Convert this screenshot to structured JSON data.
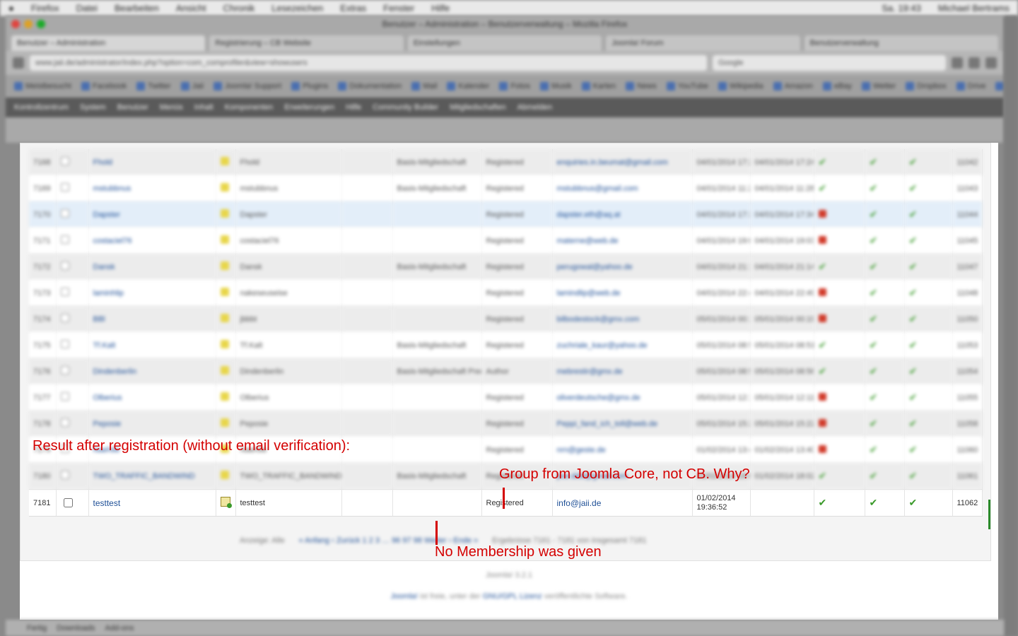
{
  "menubar": {
    "items": [
      "Firefox",
      "Datei",
      "Bearbeiten",
      "Ansicht",
      "Chronik",
      "Lesezeichen",
      "Extras",
      "Fenster",
      "Hilfe"
    ],
    "clock": "Sa. 19:43",
    "user": "Michael Bertrams"
  },
  "window": {
    "title": "Benutzer – Administration – Benutzerverwaltung – Mozilla Firefox",
    "tabs": [
      "Benutzer – Administration",
      "Registrierung – CB Website",
      "Einstellungen",
      "Joomla! Forum",
      "Benutzerverwaltung"
    ],
    "url": "www.jaii.de/administrator/index.php?option=com_comprofiler&view=showusers",
    "search": "Google"
  },
  "bookmarks": [
    "Meistbesucht",
    "Facebook",
    "Twitter",
    "Jaii",
    "Joomla! Support",
    "Plugins",
    "Dokumentation",
    "Mail",
    "Kalender",
    "Fotos",
    "Musik",
    "Karten",
    "News",
    "YouTube",
    "Wikipedia",
    "Amazon",
    "eBay",
    "Wetter",
    "Dropbox",
    "Drive",
    "Notizen",
    "Kontakte",
    "Einstellungen"
  ],
  "adminbar": [
    "Kontrollzentrum",
    "System",
    "Benutzer",
    "Menüs",
    "Inhalt",
    "Komponenten",
    "Erweiterungen",
    "Hilfe",
    "Community Builder",
    "Mitgliedschaften",
    "Abmelden"
  ],
  "table": {
    "blurred_rows": [
      {
        "id": "7168",
        "username": "Fhold",
        "name": "Fhold",
        "membership": "Basis-Mitgliedschaft",
        "group": "Registered",
        "email": "enquiries.in.beumat@gmail.com",
        "date1": "04/01/2014 17:24:22",
        "date2": "04/01/2014 17:24:22",
        "status": [
          "ok",
          "ok",
          "ok"
        ],
        "uid": "11042"
      },
      {
        "id": "7169",
        "username": "mstubbnus",
        "name": "mstubbnus",
        "membership": "Basis-Mitgliedschaft",
        "group": "Registered",
        "email": "mstubbnus@gmail.com",
        "date1": "04/01/2014 11:28:00",
        "date2": "04/01/2014 11:28:00",
        "status": [
          "ok",
          "ok",
          "ok"
        ],
        "uid": "11043"
      },
      {
        "id": "7170",
        "username": "Dapster",
        "name": "Dapster",
        "membership": "",
        "group": "Registered",
        "email": "dapster.eth@aq.at",
        "date1": "04/01/2014 17:34:02",
        "date2": "04/01/2014 17:34:02",
        "status": [
          "bad",
          "ok",
          "ok"
        ],
        "uid": "11044"
      },
      {
        "id": "7171",
        "username": "costaciel76",
        "name": "costaciel76",
        "membership": "",
        "group": "Registered",
        "email": "materne@web.de",
        "date1": "04/01/2014 19:03:11",
        "date2": "04/01/2014 19:03:11",
        "status": [
          "bad",
          "ok",
          "ok"
        ],
        "uid": "11045"
      },
      {
        "id": "7172",
        "username": "Dansk",
        "name": "Dansk",
        "membership": "Basis-Mitgliedschaft",
        "group": "Registered",
        "email": "perugowal@yahoo.de",
        "date1": "04/01/2014 21:14:06",
        "date2": "04/01/2014 21:14:06",
        "status": [
          "ok",
          "ok",
          "ok"
        ],
        "uid": "11047"
      },
      {
        "id": "7173",
        "username": "laminhlip",
        "name": "nakeseuseise",
        "membership": "",
        "group": "Registered",
        "email": "lamindlip@web.de",
        "date1": "04/01/2014 22:49:51",
        "date2": "04/01/2014 22:49:51",
        "status": [
          "bad",
          "ok",
          "ok"
        ],
        "uid": "11048"
      },
      {
        "id": "7174",
        "username": "BBl",
        "name": "jbbbt",
        "membership": "",
        "group": "Registered",
        "email": "bilbodestock@gmx.com",
        "date1": "05/01/2014 00:19:12",
        "date2": "05/01/2014 00:19:12",
        "status": [
          "bad",
          "ok",
          "ok"
        ],
        "uid": "11050"
      },
      {
        "id": "7175",
        "username": "Tf.Kalt",
        "name": "Tf.Kalt",
        "membership": "Basis-Mitgliedschaft",
        "group": "Registered",
        "email": "zuchriale_kaur@yahoo.de",
        "date1": "05/01/2014 08:51:37",
        "date2": "05/01/2014 08:51:37",
        "status": [
          "ok",
          "ok",
          "ok"
        ],
        "uid": "11053"
      },
      {
        "id": "7176",
        "username": "Dindenberlin",
        "name": "Dindenberlin",
        "membership": "Basis-Mitgliedschaft Premium",
        "group": "Author",
        "email": "mebrestir@gmx.de",
        "date1": "05/01/2014 08:56:12",
        "date2": "05/01/2014 08:56:12",
        "status": [
          "ok",
          "ok",
          "ok"
        ],
        "uid": "11054"
      },
      {
        "id": "7177",
        "username": "Olberius",
        "name": "Olberius",
        "membership": "",
        "group": "Registered",
        "email": "oliverdeutsche@gmx.de",
        "date1": "05/01/2014 12:11:23",
        "date2": "05/01/2014 12:11:23",
        "status": [
          "bad",
          "ok",
          "ok"
        ],
        "uid": "11055"
      },
      {
        "id": "7178",
        "username": "Peposie",
        "name": "Peposie",
        "membership": "",
        "group": "Registered",
        "email": "Peppi_fand_ich_toll@web.de",
        "date1": "05/01/2014 15:22:31",
        "date2": "05/01/2014 15:22:31",
        "status": [
          "bad",
          "ok",
          "ok"
        ],
        "uid": "11058"
      },
      {
        "id": "7179",
        "username": "Naehtle",
        "name": "Naehtle",
        "membership": "",
        "group": "Registered",
        "email": "nrn@geste.de",
        "date1": "01/02/2014 13:40:02",
        "date2": "01/02/2014 13:40:02",
        "status": [
          "bad",
          "ok",
          "ok"
        ],
        "uid": "11060"
      },
      {
        "id": "7180",
        "username": "TWO_TRAFFIC_BANDWIND",
        "name": "TWO_TRAFFIC_BANDWIND",
        "membership": "Basis-Mitgliedschaft",
        "group": "Registered",
        "email": "pse.ddd@gmail.com",
        "date1": "01/02/2014 18:02:19",
        "date2": "01/02/2014 18:02:19",
        "status": [
          "ok",
          "ok",
          "ok"
        ],
        "uid": "11061"
      }
    ],
    "highlighted_row": {
      "id": "7181",
      "username": "testtest",
      "name": "testtest",
      "group": "Registered",
      "email": "info@jaii.de",
      "reg_date": "01/02/2014",
      "reg_time": "19:36:52",
      "uid": "11062"
    }
  },
  "pagination": {
    "display": "Anzeige: Alle",
    "pages": "« Anfang ‹ Zurück 1 2 3 … 96 97 98 Weiter › Ende »",
    "results": "Ergebnisse 7161 - 7181 von insgesamt 7181"
  },
  "footer": {
    "version": "Joomla! 3.2.1",
    "line_prefix": "Joomla!",
    "line_text": "ist freie, unter der",
    "line_link": "GNU/GPL Lizenz",
    "line_suffix": "veröffentlichte Software."
  },
  "statusbar": [
    "Fertig",
    "Downloads",
    "Add-ons"
  ],
  "annotations": {
    "result": "Result after registration (without email verification):",
    "group": "Group from Joomla Core, not CB. Why?",
    "membership": "No Membership was given"
  },
  "colors": {
    "annotation": "#d40000",
    "link": "#1e4f96",
    "ok": "#3a9a2a",
    "bad": "#d13b2b"
  }
}
